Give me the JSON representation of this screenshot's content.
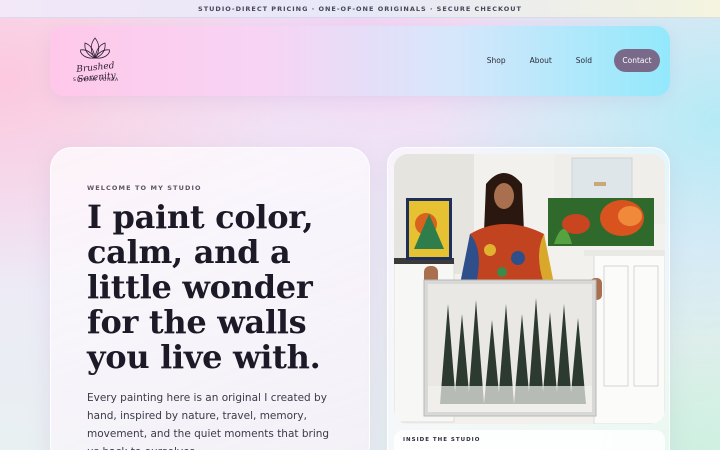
{
  "announcement": "STUDIO-DIRECT PRICING · ONE-OF-ONE ORIGINALS · SECURE CHECKOUT",
  "brand": {
    "script": "Brushed Serenity",
    "name": "SHIVANI VOHRA",
    "icon": "lotus-icon"
  },
  "nav": {
    "items": [
      "Shop",
      "About",
      "Sold"
    ],
    "contact": "Contact"
  },
  "hero": {
    "eyebrow": "WELCOME TO MY STUDIO",
    "headline": "I paint color, calm, and a little wonder for the walls you live with.",
    "intro": "Every painting here is an original I created by hand, inspired by nature, travel, memory, movement, and the quiet moments that bring us back to ourselves."
  },
  "studio": {
    "caption": "INSIDE THE STUDIO"
  },
  "colors": {
    "contact_bg": "#7a6a8a",
    "heading": "#1d1a28"
  }
}
